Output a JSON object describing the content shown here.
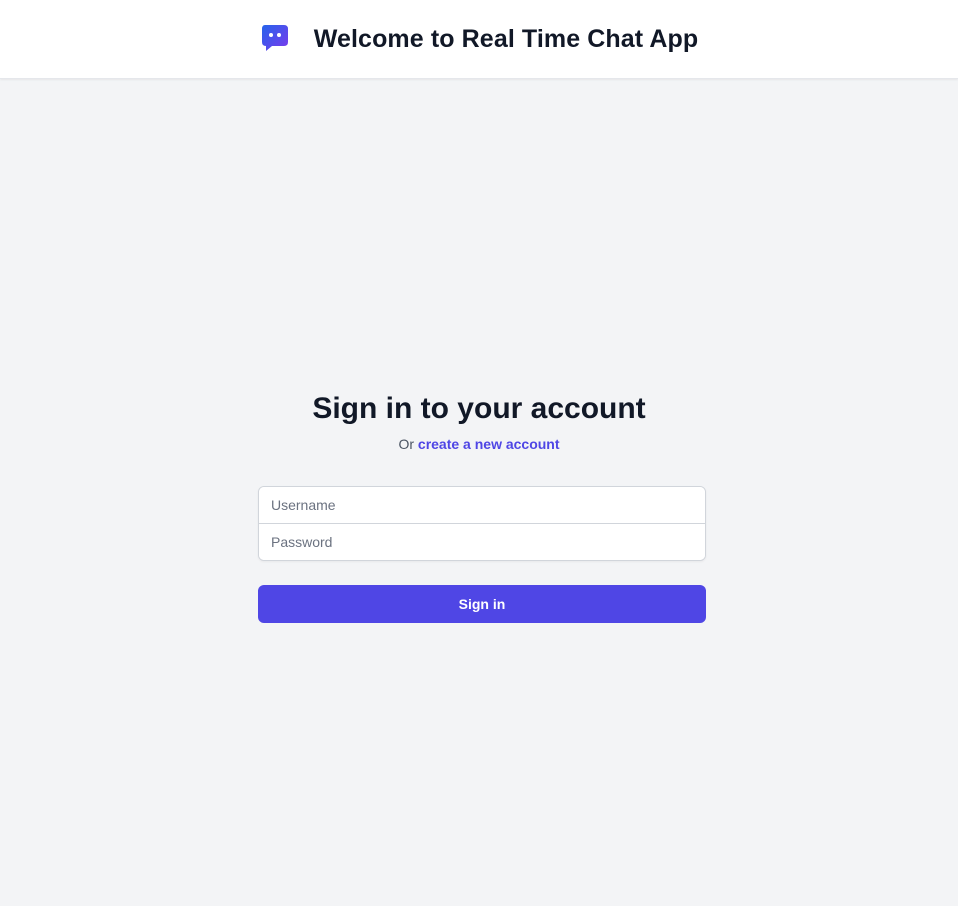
{
  "header": {
    "logo_icon": "chat-bubble-icon",
    "title": "Welcome to Real Time Chat App"
  },
  "signin": {
    "title": "Sign in to your account",
    "prefix": "Or",
    "create_account_link": "create a new account",
    "username_placeholder": "Username",
    "username_value": "",
    "password_placeholder": "Password",
    "password_value": "",
    "button_label": "Sign in"
  },
  "colors": {
    "accent": "#4f46e5",
    "background": "#f3f4f6",
    "heading": "#111827",
    "logo_gradient_start": "#2563eb",
    "logo_gradient_end": "#7c3aed"
  }
}
